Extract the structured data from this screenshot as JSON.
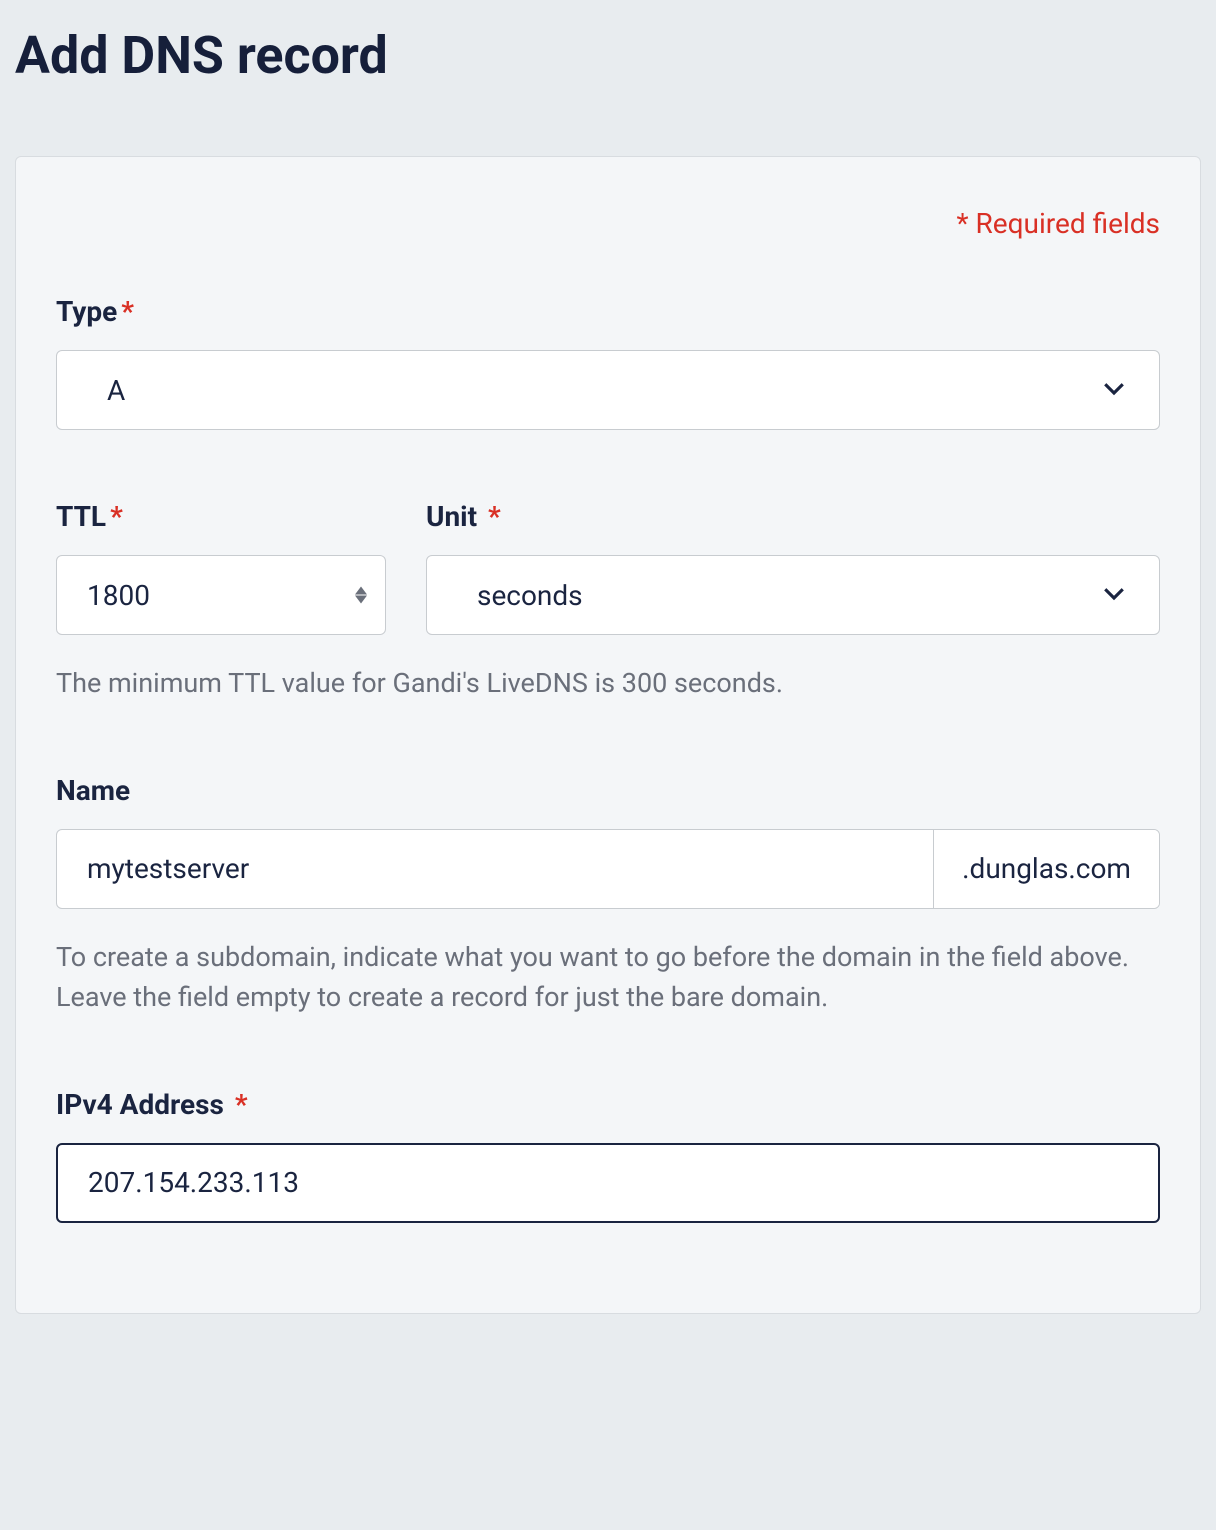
{
  "page": {
    "title": "Add DNS record",
    "required_fields_label": "* Required fields"
  },
  "type": {
    "label": "Type",
    "value": "A"
  },
  "ttl": {
    "label": "TTL",
    "value": "1800",
    "help": "The minimum TTL value for Gandi's LiveDNS is 300 seconds."
  },
  "unit": {
    "label": "Unit",
    "value": "seconds"
  },
  "name": {
    "label": "Name",
    "value": "mytestserver",
    "suffix": ".dunglas.com",
    "help": "To create a subdomain, indicate what you want to go before the domain in the field above. Leave the field empty to create a record for just the bare domain."
  },
  "ipv4": {
    "label": "IPv4 Address",
    "value": "207.154.233.113"
  }
}
